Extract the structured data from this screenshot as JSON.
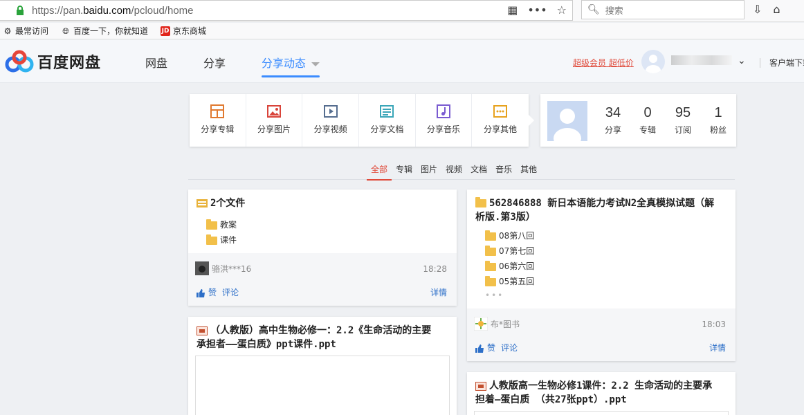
{
  "browser": {
    "url_prefix": "https://pan.",
    "url_host": "baidu.com",
    "url_path": "/pcloud/home",
    "search_placeholder": "搜索",
    "bookmarks": [
      "最常访问",
      "百度一下，你就知道",
      "京东商城"
    ],
    "jd_badge": "JD"
  },
  "header": {
    "logo_text": "百度网盘",
    "nav": [
      "网盘",
      "分享",
      "分享动态"
    ],
    "vip_link": "超级会员 超低价",
    "client_link": "客户端下载"
  },
  "share_panel": {
    "items": [
      "分享专辑",
      "分享图片",
      "分享视频",
      "分享文档",
      "分享音乐",
      "分享其他"
    ]
  },
  "profile": {
    "stats": [
      {
        "num": "34",
        "label": "分享"
      },
      {
        "num": "0",
        "label": "专辑"
      },
      {
        "num": "95",
        "label": "订阅"
      },
      {
        "num": "1",
        "label": "粉丝"
      }
    ]
  },
  "filters": [
    "全部",
    "专辑",
    "图片",
    "视频",
    "文档",
    "音乐",
    "其他"
  ],
  "cards": {
    "c1": {
      "title": "2个文件",
      "files": [
        "教案",
        "课件"
      ],
      "user": "骆洪***16",
      "time": "18:28",
      "like": "赞",
      "comment": "评论",
      "detail": "详情"
    },
    "c2": {
      "title_line1": "562846888 新日本语能力考试N2全真模拟试题（解",
      "title_line2": "析版.第3版）",
      "files": [
        "08第八回",
        "07第七回",
        "06第六回",
        "05第五回"
      ],
      "more": "•••",
      "user": "布*图书",
      "time": "18:03",
      "like": "赞",
      "comment": "评论",
      "detail": "详情"
    },
    "c3": {
      "title_line1": "（人教版）高中生物必修一：2.2《生命活动的主要",
      "title_line2": "承担者——蛋白质》ppt课件.ppt"
    },
    "c4": {
      "title_line1": "人教版高一生物必修1课件：2.2 生命活动的主要承",
      "title_line2": "担着—蛋白质 （共27张ppt）.ppt"
    }
  },
  "colors": {
    "accent": "#3b8cff",
    "red": "#e04a3a",
    "link": "#2d6fc8"
  }
}
